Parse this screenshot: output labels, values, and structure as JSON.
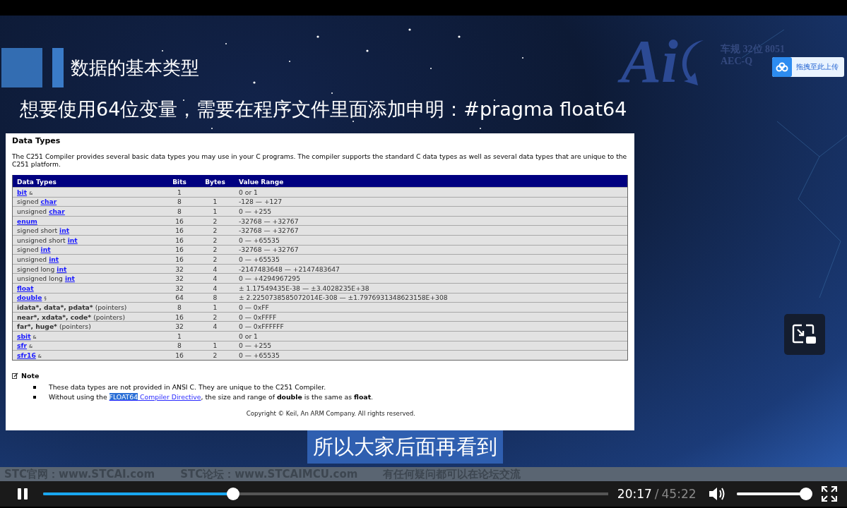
{
  "slide": {
    "title": "数据的基本类型",
    "subtitle": "想要使用64位变量，需要在程序文件里面添加申明：#pragma float64",
    "logo": {
      "mark": "Ai",
      "line_1": "车规 32位 8051",
      "line_2": "AEC-Q"
    },
    "footer": [
      "STC官网：www.STCAI.com",
      "STC论坛：www.STCAIMCU.com",
      "有任何疑问都可以在论坛交流"
    ]
  },
  "upload_button": {
    "label": "拖拽至此上传"
  },
  "document": {
    "heading": "Data Types",
    "intro": "The C251 Compiler provides several basic data types you may use in your C programs. The compiler supports the standard C data types as well as several data types that are unique to the C251 platform.",
    "columns": [
      "Data Types",
      "Bits",
      "Bytes",
      "Value Range"
    ],
    "rows": [
      {
        "type": [
          {
            "kind": "link",
            "text": "bit"
          },
          {
            "kind": "sup",
            "text": "&"
          }
        ],
        "bits": "1",
        "value": "0 or 1"
      },
      {
        "type": [
          {
            "kind": "plain",
            "text": "signed"
          },
          {
            "kind": "link",
            "text": "char"
          }
        ],
        "bits": "8",
        "bytes": "1",
        "value": "-128 — +127"
      },
      {
        "type": [
          {
            "kind": "plain",
            "text": "unsigned"
          },
          {
            "kind": "link",
            "text": "char"
          }
        ],
        "bits": "8",
        "bytes": "1",
        "value": "0 — +255"
      },
      {
        "type": [
          {
            "kind": "link",
            "text": "enum"
          }
        ],
        "bits": "16",
        "bytes": "2",
        "value": "-32768 — +32767"
      },
      {
        "type": [
          {
            "kind": "plain",
            "text": "signed short"
          },
          {
            "kind": "link",
            "text": "int"
          }
        ],
        "bits": "16",
        "bytes": "2",
        "value": "-32768 — +32767"
      },
      {
        "type": [
          {
            "kind": "plain",
            "text": "unsigned short"
          },
          {
            "kind": "link",
            "text": "int"
          }
        ],
        "bits": "16",
        "bytes": "2",
        "value": "0 — +65535"
      },
      {
        "type": [
          {
            "kind": "plain",
            "text": "signed"
          },
          {
            "kind": "link",
            "text": "int"
          }
        ],
        "bits": "16",
        "bytes": "2",
        "value": "-32768 — +32767"
      },
      {
        "type": [
          {
            "kind": "plain",
            "text": "unsigned"
          },
          {
            "kind": "link",
            "text": "int"
          }
        ],
        "bits": "16",
        "bytes": "2",
        "value": "0 — +65535"
      },
      {
        "type": [
          {
            "kind": "plain",
            "text": "signed long"
          },
          {
            "kind": "link",
            "text": "int"
          }
        ],
        "bits": "32",
        "bytes": "4",
        "value": "-2147483648 — +2147483647"
      },
      {
        "type": [
          {
            "kind": "plain",
            "text": "unsigned long"
          },
          {
            "kind": "link",
            "text": "int"
          }
        ],
        "bits": "32",
        "bytes": "4",
        "value": "0 — +4294967295"
      },
      {
        "type": [
          {
            "kind": "link",
            "text": "float"
          }
        ],
        "bits": "32",
        "bytes": "4",
        "value": "± 1.17549435E-38 — ±3.4028235E+38"
      },
      {
        "type": [
          {
            "kind": "link",
            "text": "double"
          },
          {
            "kind": "sup",
            "text": "§"
          }
        ],
        "bits": "64",
        "bytes": "8",
        "value": "± 2.2250738585072014E-308 — ±1.7976931348623158E+308"
      },
      {
        "type": [
          {
            "kind": "bold",
            "text": "idata*, data*, pdata*"
          },
          {
            "kind": "plain",
            "text": "(pointers)"
          }
        ],
        "bits": "8",
        "bytes": "1",
        "value": "0 — 0xFF"
      },
      {
        "type": [
          {
            "kind": "bold",
            "text": "near*, xdata*, code*"
          },
          {
            "kind": "plain",
            "text": "(pointers)"
          }
        ],
        "bits": "16",
        "bytes": "2",
        "value": "0 — 0xFFFF"
      },
      {
        "type": [
          {
            "kind": "bold",
            "text": "far*, huge*"
          },
          {
            "kind": "plain",
            "text": "(pointers)"
          }
        ],
        "bits": "32",
        "bytes": "4",
        "value": "0 — 0xFFFFFF"
      },
      {
        "type": [
          {
            "kind": "link",
            "text": "sbit"
          },
          {
            "kind": "sup",
            "text": "&"
          }
        ],
        "bits": "1",
        "value": "0 or 1"
      },
      {
        "type": [
          {
            "kind": "link",
            "text": "sfr"
          },
          {
            "kind": "sup",
            "text": "&"
          }
        ],
        "bits": "8",
        "bytes": "1",
        "value": "0 — +255"
      },
      {
        "type": [
          {
            "kind": "link",
            "text": "sfr16"
          },
          {
            "kind": "sup",
            "text": "&"
          }
        ],
        "bits": "16",
        "bytes": "2",
        "value": "0 — +65535"
      }
    ],
    "note": {
      "title": "Note",
      "items": [
        {
          "before": "These data types are not provided in ANSI C. They are unique to the C251 Compiler."
        },
        {
          "before": "Without using the ",
          "link": [
            {
              "text": "FLOAT64",
              "selected": true
            },
            {
              "text": " Compiler Directive",
              "selected": false
            }
          ],
          "after": ", the size and range of **double** is the same as **float**."
        }
      ]
    },
    "copyright": "Copyright © Keil, An ARM Company. All rights reserved."
  },
  "caption": "所以大家后面再看到",
  "player": {
    "playing": true,
    "progress": {
      "level": 0.336
    },
    "current_time": "20:17",
    "separator": "/",
    "duration": "45:22",
    "volume": {
      "level": 1.0
    }
  }
}
